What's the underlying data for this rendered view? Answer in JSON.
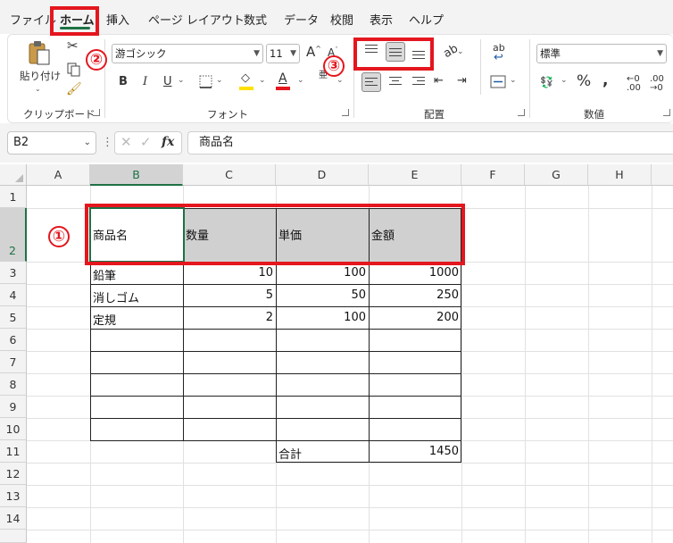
{
  "menu": {
    "items": [
      "ファイル",
      "ホーム",
      "挿入",
      "ページ レイアウト",
      "数式",
      "データ",
      "校閲",
      "表示",
      "ヘルプ"
    ],
    "active": "ホーム"
  },
  "ribbon": {
    "clipboard": {
      "paste_label": "貼り付け",
      "group_label": "クリップボード"
    },
    "font": {
      "name": "游ゴシック",
      "size": "11",
      "group_label": "フォント",
      "fill_color": "#ffe000",
      "font_color": "#e4161e"
    },
    "alignment": {
      "group_label": "配置",
      "wrap_label": "ab"
    },
    "number": {
      "format": "標準",
      "group_label": "数値"
    }
  },
  "formula_bar": {
    "name_box": "B2",
    "fx_label": "fx",
    "content": "商品名"
  },
  "columns": [
    "A",
    "B",
    "C",
    "D",
    "E",
    "F",
    "G",
    "H"
  ],
  "rows": [
    "1",
    "2",
    "3",
    "4",
    "5",
    "6",
    "7",
    "8",
    "9",
    "10",
    "11",
    "12",
    "13",
    "14"
  ],
  "table": {
    "headers": [
      "商品名",
      "数量",
      "単価",
      "金額"
    ],
    "rows": [
      [
        "鉛筆",
        "10",
        "100",
        "1000"
      ],
      [
        "消しゴム",
        "5",
        "50",
        "250"
      ],
      [
        "定規",
        "2",
        "100",
        "200"
      ]
    ],
    "total_label": "合計",
    "total_value": "1450"
  },
  "annotations": {
    "one": "①",
    "two": "②",
    "three": "③",
    "color": "#e4161e"
  }
}
